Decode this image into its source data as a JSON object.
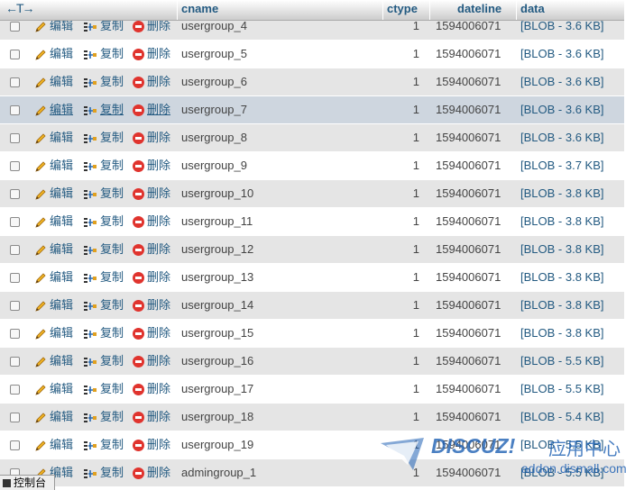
{
  "header": {
    "arrows": "←T→",
    "columns": [
      "cname",
      "ctype",
      "dateline",
      "data"
    ]
  },
  "actions": {
    "edit": "编辑",
    "copy": "复制",
    "delete": "删除"
  },
  "rows": [
    {
      "cname": "usergroup_4",
      "ctype": "1",
      "dateline": "1594006071",
      "data": "[BLOB - 3.6 KB]"
    },
    {
      "cname": "usergroup_5",
      "ctype": "1",
      "dateline": "1594006071",
      "data": "[BLOB - 3.6 KB]"
    },
    {
      "cname": "usergroup_6",
      "ctype": "1",
      "dateline": "1594006071",
      "data": "[BLOB - 3.6 KB]"
    },
    {
      "cname": "usergroup_7",
      "ctype": "1",
      "dateline": "1594006071",
      "data": "[BLOB - 3.6 KB]"
    },
    {
      "cname": "usergroup_8",
      "ctype": "1",
      "dateline": "1594006071",
      "data": "[BLOB - 3.6 KB]"
    },
    {
      "cname": "usergroup_9",
      "ctype": "1",
      "dateline": "1594006071",
      "data": "[BLOB - 3.7 KB]"
    },
    {
      "cname": "usergroup_10",
      "ctype": "1",
      "dateline": "1594006071",
      "data": "[BLOB - 3.8 KB]"
    },
    {
      "cname": "usergroup_11",
      "ctype": "1",
      "dateline": "1594006071",
      "data": "[BLOB - 3.8 KB]"
    },
    {
      "cname": "usergroup_12",
      "ctype": "1",
      "dateline": "1594006071",
      "data": "[BLOB - 3.8 KB]"
    },
    {
      "cname": "usergroup_13",
      "ctype": "1",
      "dateline": "1594006071",
      "data": "[BLOB - 3.8 KB]"
    },
    {
      "cname": "usergroup_14",
      "ctype": "1",
      "dateline": "1594006071",
      "data": "[BLOB - 3.8 KB]"
    },
    {
      "cname": "usergroup_15",
      "ctype": "1",
      "dateline": "1594006071",
      "data": "[BLOB - 3.8 KB]"
    },
    {
      "cname": "usergroup_16",
      "ctype": "1",
      "dateline": "1594006071",
      "data": "[BLOB - 5.5 KB]"
    },
    {
      "cname": "usergroup_17",
      "ctype": "1",
      "dateline": "1594006071",
      "data": "[BLOB - 5.5 KB]"
    },
    {
      "cname": "usergroup_18",
      "ctype": "1",
      "dateline": "1594006071",
      "data": "[BLOB - 5.4 KB]"
    },
    {
      "cname": "usergroup_19",
      "ctype": "1",
      "dateline": "1594006071",
      "data": "[BLOB - 5.5 KB]"
    },
    {
      "cname": "admingroup_1",
      "ctype": "1",
      "dateline": "1594006071",
      "data": "[BLOB - 5.5 KB]"
    }
  ],
  "hover_row_index": 3,
  "watermark": {
    "brand": "DISCUZ!",
    "cn": "应用中心",
    "url": "addon.dismall.com"
  },
  "console": {
    "label": "控制台"
  },
  "colors": {
    "link": "#235a81",
    "row_even": "#e5e5e5",
    "row_hover": "#ced6df",
    "delete_red": "#e0342e",
    "watermark_blue": "#1f61b4"
  }
}
